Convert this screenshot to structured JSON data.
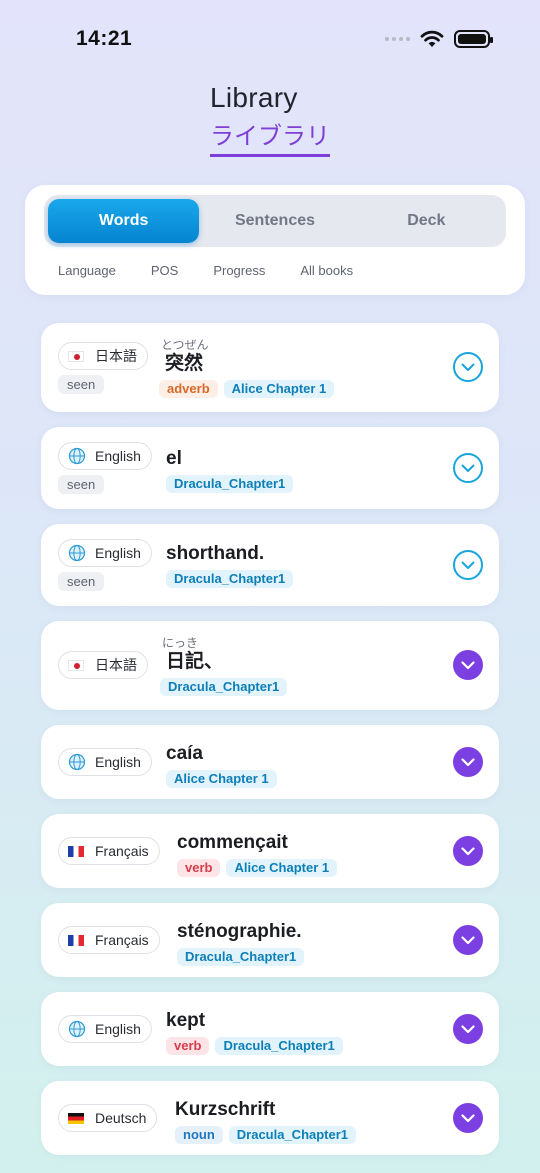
{
  "status": {
    "time": "14:21"
  },
  "header": {
    "title": "Library",
    "subtitle": "ライブラリ"
  },
  "tabs": [
    {
      "label": "Words",
      "active": true
    },
    {
      "label": "Sentences",
      "active": false
    },
    {
      "label": "Deck",
      "active": false
    }
  ],
  "filters": [
    "Language",
    "POS",
    "Progress",
    "All books"
  ],
  "colors": {
    "accent": "#0a8fd8",
    "purple": "#7c3fe2"
  },
  "words": [
    {
      "lang": "日本語",
      "flag": "jp",
      "seen": "seen",
      "reading": "とつぜん",
      "word": "突然",
      "pos": "adverb",
      "book": "Alice Chapter 1",
      "expand": "outline-chevron-icon"
    },
    {
      "lang": "English",
      "flag": "globe",
      "seen": "seen",
      "reading": "",
      "word": "el",
      "pos": "",
      "book": "Dracula_Chapter1",
      "expand": "outline-chevron-icon"
    },
    {
      "lang": "English",
      "flag": "globe",
      "seen": "seen",
      "reading": "",
      "word": "shorthand.",
      "pos": "",
      "book": "Dracula_Chapter1",
      "expand": "outline-chevron-icon"
    },
    {
      "lang": "日本語",
      "flag": "jp",
      "seen": "",
      "reading": "にっき",
      "word": "日記、",
      "pos": "",
      "book": "Dracula_Chapter1",
      "expand": "filled-chevron-icon"
    },
    {
      "lang": "English",
      "flag": "globe",
      "seen": "",
      "reading": "",
      "word": "caía",
      "pos": "",
      "book": "Alice Chapter 1",
      "expand": "filled-chevron-icon"
    },
    {
      "lang": "Français",
      "flag": "fr",
      "seen": "",
      "reading": "",
      "word": "commençait",
      "pos": "verb",
      "book": "Alice Chapter 1",
      "expand": "filled-chevron-icon"
    },
    {
      "lang": "Français",
      "flag": "fr",
      "seen": "",
      "reading": "",
      "word": "sténographie.",
      "pos": "",
      "book": "Dracula_Chapter1",
      "expand": "filled-chevron-icon"
    },
    {
      "lang": "English",
      "flag": "globe",
      "seen": "",
      "reading": "",
      "word": "kept",
      "pos": "verb",
      "book": "Dracula_Chapter1",
      "expand": "filled-chevron-icon"
    },
    {
      "lang": "Deutsch",
      "flag": "de",
      "seen": "",
      "reading": "",
      "word": "Kurzschrift",
      "pos": "noun",
      "book": "Dracula_Chapter1",
      "expand": "filled-chevron-icon"
    }
  ]
}
